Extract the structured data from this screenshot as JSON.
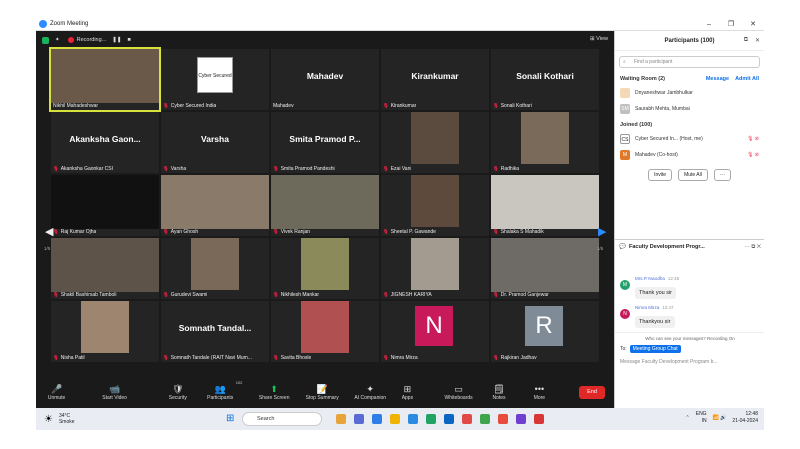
{
  "window": {
    "title": "Zoom Meeting"
  },
  "top": {
    "recording": "Recording...",
    "view": "View"
  },
  "tiles": [
    {
      "name": "Nikhil Mahadeshwar",
      "muted": false,
      "kind": "photo",
      "color": "#6a5848"
    },
    {
      "name": "Cyber Secured India",
      "muted": true,
      "kind": "logo",
      "logo_text": "Cyber Secured India"
    },
    {
      "name": "Mahadev",
      "muted": false,
      "kind": "text",
      "big": "Mahadev"
    },
    {
      "name": "Kirankumar",
      "muted": true,
      "kind": "text",
      "big": "Kirankumar"
    },
    {
      "name": "Sonali Kothari",
      "muted": true,
      "kind": "text",
      "big": "Sonali Kothari"
    },
    {
      "name": "Akanksha Gaonkar CSI",
      "muted": true,
      "kind": "text",
      "big": "Akanksha Gaon..."
    },
    {
      "name": "Varsha",
      "muted": true,
      "kind": "text",
      "big": "Varsha"
    },
    {
      "name": "Smita Pramod Pandeshi",
      "muted": true,
      "kind": "text",
      "big": "Smita Pramod P..."
    },
    {
      "name": "Ezai Vani",
      "muted": true,
      "kind": "photo",
      "color": "#5b4a3e"
    },
    {
      "name": "Radhika",
      "muted": true,
      "kind": "photo",
      "color": "#7a6a5a"
    },
    {
      "name": "Raj Kumar Ojha",
      "muted": true,
      "kind": "photo",
      "color": "#111111"
    },
    {
      "name": "Ayan Ghosh",
      "muted": true,
      "kind": "photo",
      "color": "#8a7a6a"
    },
    {
      "name": "Vivek Ranjan",
      "muted": true,
      "kind": "photo",
      "color": "#6d6a5c"
    },
    {
      "name": "Sheetal P. Gawande",
      "muted": true,
      "kind": "photo",
      "color": "#5e4a3c"
    },
    {
      "name": "Shalaka S Mahadik",
      "muted": true,
      "kind": "photo",
      "color": "#c9c5bf"
    },
    {
      "name": "Shakil Bashirsab Tamboli",
      "muted": true,
      "kind": "photo",
      "color": "#5d5348"
    },
    {
      "name": "Gurudevi Swami",
      "muted": true,
      "kind": "photo",
      "color": "#7a6858"
    },
    {
      "name": "Nikhilesh Mankar",
      "muted": true,
      "kind": "photo",
      "color": "#8b8a5a"
    },
    {
      "name": "JIGNESH KARIYA",
      "muted": true,
      "kind": "photo",
      "color": "#a39a90"
    },
    {
      "name": "Dr. Pramod Ganjewar",
      "muted": true,
      "kind": "photo",
      "color": "#6e6a66"
    },
    {
      "name": "Nisha Patil",
      "muted": true,
      "kind": "photo",
      "color": "#9d8570"
    },
    {
      "name": "Somnath Tandale (RAIT Navi Mum...",
      "muted": true,
      "kind": "text",
      "big": "Somnath Tandal..."
    },
    {
      "name": "Savita Bhosle",
      "muted": true,
      "kind": "photo",
      "color": "#b05050"
    },
    {
      "name": "Nimra Mirza",
      "muted": true,
      "kind": "avatar",
      "letter": "N",
      "color": "#c8195a"
    },
    {
      "name": "Rajkiran Jadhav",
      "muted": true,
      "kind": "avatar",
      "letter": "R",
      "color": "#7f8b96"
    }
  ],
  "page_left": "1/5",
  "page_right": "1/5",
  "toolbar": {
    "items": [
      {
        "label": "Unmute",
        "icon": "mic-off-icon",
        "glyph": "🎤"
      },
      {
        "label": "Start Video",
        "icon": "video-off-icon",
        "glyph": "📹"
      },
      {
        "label": "Security",
        "icon": "shield-icon",
        "glyph": "🛡"
      },
      {
        "label": "Participants",
        "icon": "participants-icon",
        "glyph": "👥",
        "count": "102"
      },
      {
        "label": "Share Screen",
        "icon": "share-screen-icon",
        "glyph": "⬆",
        "accent": "#19c15e"
      },
      {
        "label": "Stop Summary",
        "icon": "summary-icon",
        "glyph": "📝"
      },
      {
        "label": "AI Companion",
        "icon": "ai-companion-icon",
        "glyph": "✦"
      },
      {
        "label": "Apps",
        "icon": "apps-icon",
        "glyph": "⊞"
      },
      {
        "label": "Whiteboards",
        "icon": "whiteboard-icon",
        "glyph": "▭"
      },
      {
        "label": "Notes",
        "icon": "notes-icon",
        "glyph": "🗒"
      },
      {
        "label": "More",
        "icon": "more-icon",
        "glyph": "•••"
      }
    ],
    "end": "End"
  },
  "participants": {
    "title": "Participants (100)",
    "search_placeholder": "Find a participant",
    "waiting": {
      "label": "Waiting Room (2)",
      "message": "Message",
      "admit_all": "Admit All"
    },
    "waiting_list": [
      {
        "name": "Dnyaneshwar Jambhulkar",
        "initials": "",
        "color": "#f3d9b5"
      },
      {
        "name": "Saurabh Mehta, Mumbai",
        "initials": "SM",
        "color": "#c0c0c0"
      }
    ],
    "joined_label": "Joined (100)",
    "joined_list": [
      {
        "name": "Cyber Secured In... (Host, me)",
        "initials": "CS",
        "color": "#ffffff"
      },
      {
        "name": "Mahadev (Co-host)",
        "initials": "M",
        "color": "#e07a2a"
      }
    ],
    "invite": "Invite",
    "mute_all": "Mute All",
    "more": "···"
  },
  "chat": {
    "title": "Faculty Development Progr...",
    "messages": [
      {
        "sender": "Mrs.P.Yasodha",
        "time": "12:46",
        "text": "Thank you sir",
        "initial": "M",
        "color": "#22a06b"
      },
      {
        "sender": "Nimra Mirza",
        "time": "12:47",
        "text": "Thankyou sir",
        "initial": "N",
        "color": "#c8195a"
      }
    ],
    "note": "Who can see your messages? Recording On",
    "to_label": "To:",
    "to_value": "Meeting Group Chat",
    "input_placeholder": "Message Faculty Development Program b..."
  },
  "taskbar": {
    "temp": "34°C",
    "weather": "Smoke",
    "search": "Search",
    "lang_top": "ENG",
    "lang_bottom": "IN",
    "time": "12:48",
    "date": "21-04-2024"
  }
}
